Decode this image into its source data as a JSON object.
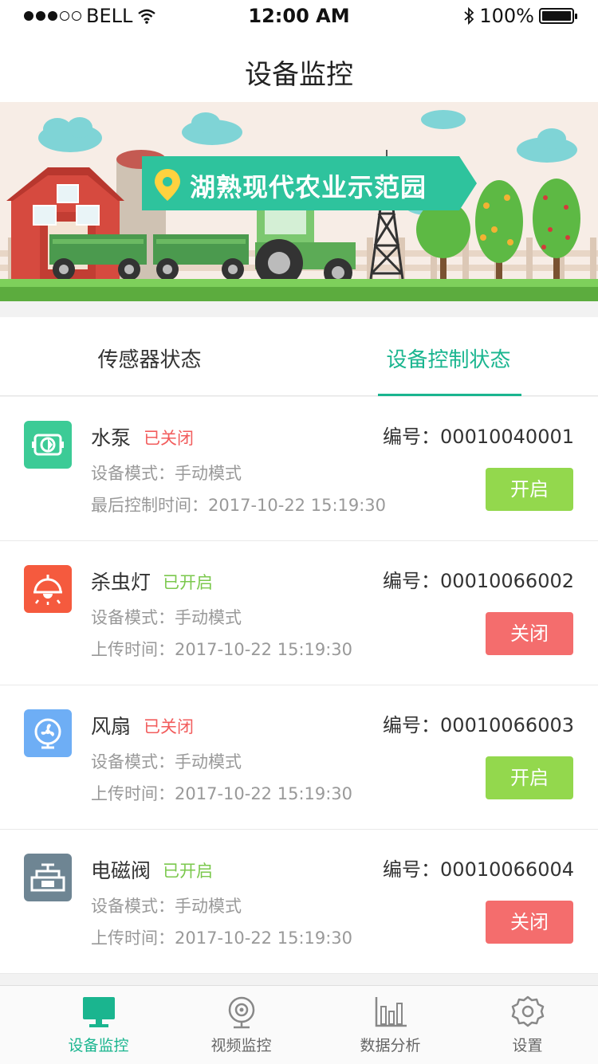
{
  "status_bar": {
    "carrier": "BELL",
    "time": "12:00 AM",
    "battery": "100%"
  },
  "header": {
    "title": "设备监控"
  },
  "banner": {
    "label": "湖熟现代农业示范园",
    "icon": "location-pin-icon"
  },
  "tabs": [
    {
      "label": "传感器状态",
      "active": false
    },
    {
      "label": "设备控制状态",
      "active": true
    }
  ],
  "devices": [
    {
      "name": "水泵",
      "status": "已关闭",
      "status_color": "#f25c5c",
      "icon": "water-pump-icon",
      "icon_color": "#3ccb96",
      "number_label": "编号：",
      "number": "00010040001",
      "line1": "设备模式：手动模式",
      "line2": "最后控制时间：2017-10-22   15:19:30",
      "button": "开启",
      "button_type": "on"
    },
    {
      "name": "杀虫灯",
      "status": "已开启",
      "status_color": "#7bc84d",
      "icon": "bug-lamp-icon",
      "icon_color": "#f55a3e",
      "number_label": "编号：",
      "number": "00010066002",
      "line1": "设备模式：手动模式",
      "line2": "上传时间：2017-10-22   15:19:30",
      "button": "关闭",
      "button_type": "off"
    },
    {
      "name": "风扇",
      "status": "已关闭",
      "status_color": "#f25c5c",
      "icon": "fan-icon",
      "icon_color": "#6eaef5",
      "number_label": "编号：",
      "number": "00010066003",
      "line1": "设备模式：手动模式",
      "line2": "上传时间：2017-10-22   15:19:30",
      "button": "开启",
      "button_type": "on"
    },
    {
      "name": "电磁阀",
      "status": "已开启",
      "status_color": "#7bc84d",
      "icon": "valve-icon",
      "icon_color": "#6e8593",
      "number_label": "编号：",
      "number": "00010066004",
      "line1": "设备模式：手动模式",
      "line2": "上传时间：2017-10-22   15:19:30",
      "button": "关闭",
      "button_type": "off"
    }
  ],
  "tabbar": [
    {
      "label": "设备监控",
      "icon": "monitor-icon",
      "active": true
    },
    {
      "label": "视频监控",
      "icon": "webcam-icon",
      "active": false
    },
    {
      "label": "数据分析",
      "icon": "bar-chart-icon",
      "active": false
    },
    {
      "label": "设置",
      "icon": "gear-icon",
      "active": false
    }
  ],
  "colors": {
    "accent": "#1ab58f",
    "button_on": "#93d84d",
    "button_off": "#f46d6d"
  }
}
